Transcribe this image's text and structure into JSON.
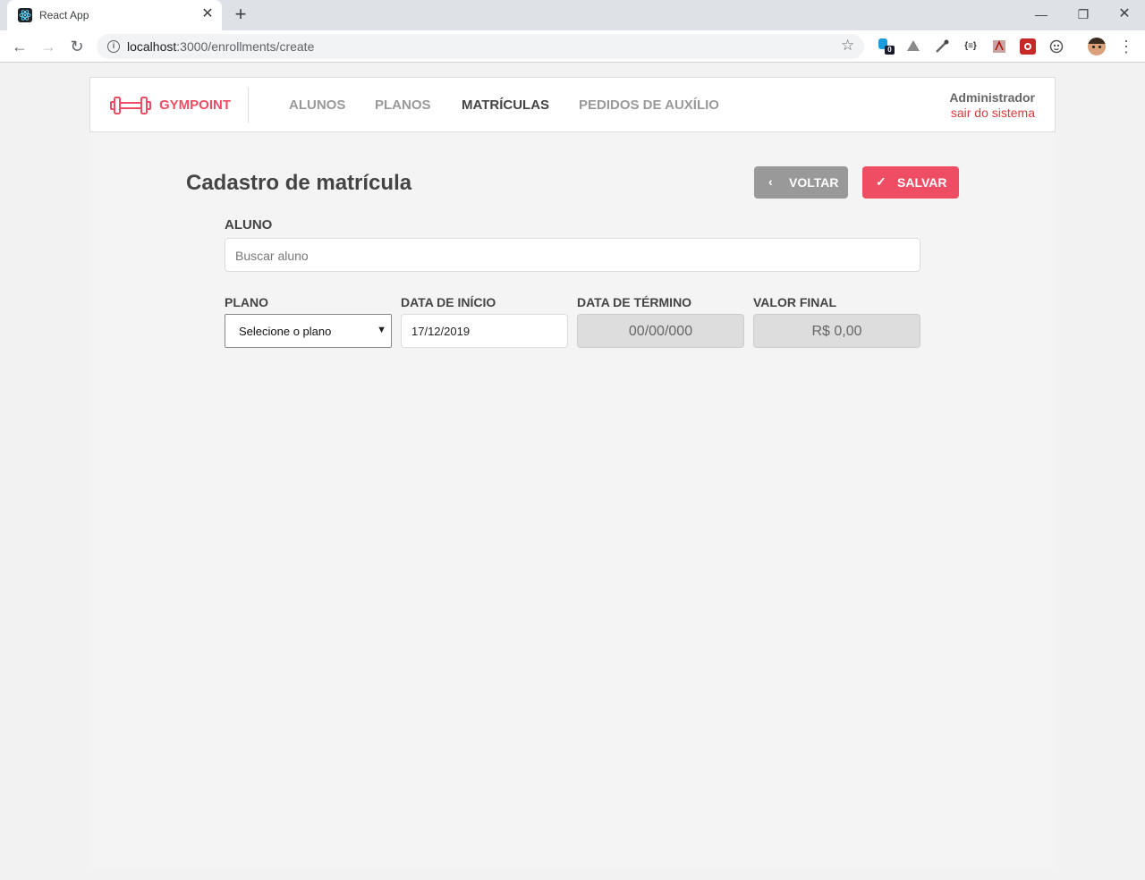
{
  "browser": {
    "tab_title": "React App",
    "url_host": "localhost",
    "url_rest": ":3000/enrollments/create",
    "extension_badge": "0"
  },
  "header": {
    "brand": "GYMPOINT",
    "nav": [
      {
        "label": "ALUNOS"
      },
      {
        "label": "PLANOS"
      },
      {
        "label": "MATRÍCULAS"
      },
      {
        "label": "PEDIDOS DE AUXÍLIO"
      }
    ],
    "user_name": "Administrador",
    "logout_label": "sair do sistema"
  },
  "page": {
    "title": "Cadastro de matrícula",
    "back_label": "VOLTAR",
    "save_label": "SALVAR"
  },
  "form": {
    "student_label": "ALUNO",
    "student_placeholder": "Buscar aluno",
    "plan_label": "PLANO",
    "plan_value": "Selecione o plano",
    "start_label": "DATA DE INÍCIO",
    "start_value": "17/12/2019",
    "end_label": "DATA DE TÉRMINO",
    "end_value": "00/00/000",
    "price_label": "VALOR FINAL",
    "price_value": "R$ 0,00"
  },
  "colors": {
    "accent": "#ee4d64",
    "back_button": "#999999",
    "background": "#f4f4f4"
  }
}
